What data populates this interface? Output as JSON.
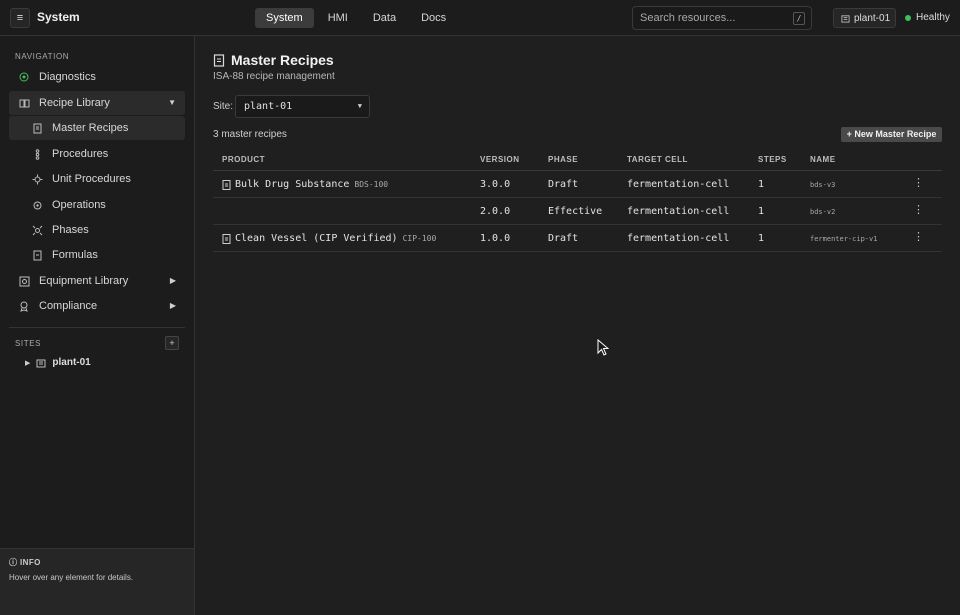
{
  "topbar": {
    "menu_icon": "hamburger-icon",
    "title": "System",
    "tabs": [
      {
        "label": "System",
        "active": true
      },
      {
        "label": "HMI",
        "active": false
      },
      {
        "label": "Data",
        "active": false
      },
      {
        "label": "Docs",
        "active": false
      }
    ],
    "search_placeholder": "Search resources...",
    "search_shortcut": "/",
    "site": "plant-01",
    "status": "Healthy",
    "status_color": "#3fbf5a"
  },
  "sidebar": {
    "nav_label": "NAVIGATION",
    "items": [
      {
        "label": "Diagnostics",
        "icon": "target-icon"
      },
      {
        "label": "Recipe Library",
        "icon": "book-icon",
        "expanded": true
      },
      {
        "label": "Master Recipes",
        "icon": "document-icon",
        "selected": true
      },
      {
        "label": "Procedures",
        "icon": "procedure-icon"
      },
      {
        "label": "Unit Procedures",
        "icon": "gear-icon"
      },
      {
        "label": "Operations",
        "icon": "cog-icon"
      },
      {
        "label": "Phases",
        "icon": "phase-icon"
      },
      {
        "label": "Formulas",
        "icon": "formula-icon"
      },
      {
        "label": "Equipment Library",
        "icon": "equipment-icon"
      },
      {
        "label": "Compliance",
        "icon": "badge-icon"
      }
    ],
    "sites_label": "SITES",
    "add_site": "+",
    "site_tree": [
      {
        "label": "plant-01"
      }
    ],
    "info_title": "INFO",
    "info_text": "Hover over any element for details."
  },
  "main": {
    "title": "Master Recipes",
    "subtitle": "ISA-88 recipe management",
    "site_label": "Site:",
    "site_value": "plant-01",
    "count": "3 master recipes",
    "new_button": "+ New Master Recipe",
    "columns": [
      "PRODUCT",
      "VERSION",
      "PHASE",
      "TARGET CELL",
      "STEPS",
      "NAME"
    ],
    "rows": [
      {
        "product": "Bulk Drug Substance",
        "code": "BDS-100",
        "version": "3.0.0",
        "phase": "Draft",
        "cell": "fermentation-cell",
        "steps": "1",
        "name": "bds-v3",
        "show_icon": true
      },
      {
        "product": "",
        "code": "",
        "version": "2.0.0",
        "phase": "Effective",
        "cell": "fermentation-cell",
        "steps": "1",
        "name": "bds-v2",
        "show_icon": false
      },
      {
        "product": "Clean Vessel (CIP Verified)",
        "code": "CIP-100",
        "version": "1.0.0",
        "phase": "Draft",
        "cell": "fermentation-cell",
        "steps": "1",
        "name": "fermenter-cip-v1",
        "show_icon": true
      }
    ]
  }
}
